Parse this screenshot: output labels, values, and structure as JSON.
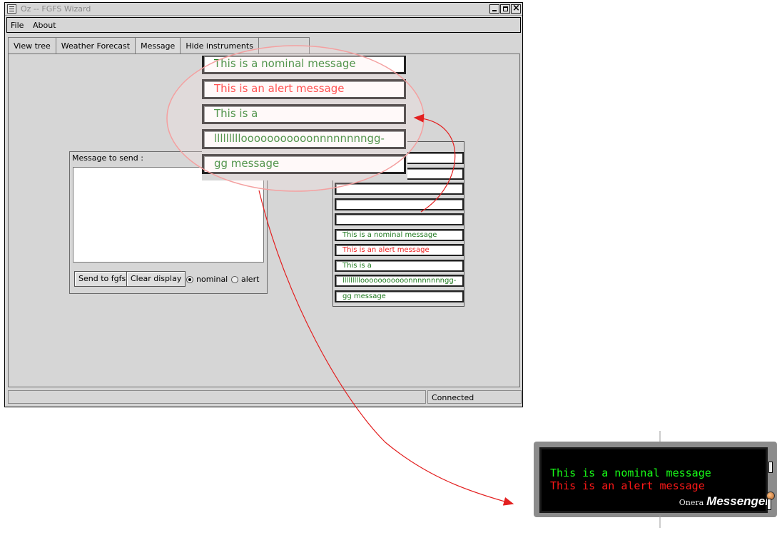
{
  "window": {
    "title": "Oz -- FGFS Wizard"
  },
  "menu": {
    "file": "File",
    "about": "About"
  },
  "tabs": [
    "View tree",
    "Weather Forecast",
    "Message",
    "Hide instruments",
    ""
  ],
  "composer": {
    "label": "Message to send :",
    "message_text": "",
    "send_button": "Send to fgfs",
    "clear_button": "Clear display",
    "radio_nominal": "nominal",
    "radio_alert": "alert",
    "selected_mode": "nominal"
  },
  "display_list": {
    "messages": [
      {
        "text": "",
        "level": "nominal"
      },
      {
        "text": "",
        "level": "nominal"
      },
      {
        "text": "",
        "level": "nominal"
      },
      {
        "text": "",
        "level": "nominal"
      },
      {
        "text": "",
        "level": "nominal"
      },
      {
        "text": "This is a nominal message",
        "level": "nominal"
      },
      {
        "text": "This is an alert message",
        "level": "alert"
      },
      {
        "text": "This is a",
        "level": "nominal"
      },
      {
        "text": "lllllllllooooooooooonnnnnnnngg-",
        "level": "nominal"
      },
      {
        "text": "gg message",
        "level": "nominal"
      }
    ]
  },
  "zoom_view": {
    "messages": [
      {
        "text": "This is a nominal message",
        "level": "nominal"
      },
      {
        "text": "This is an alert message",
        "level": "alert"
      },
      {
        "text": "This is a",
        "level": "nominal"
      },
      {
        "text": "lllllllllooooooooooonnnnnnnngg-",
        "level": "nominal"
      },
      {
        "text": "gg message",
        "level": "nominal"
      }
    ]
  },
  "status": {
    "left": "",
    "connection": "Connected"
  },
  "messenger": {
    "nominal_line": "This is a nominal message",
    "alert_line": "This is an alert message",
    "brand_prefix": "Onera",
    "brand_name": "Messenger"
  },
  "colors": {
    "nominal": "#1f7a1f",
    "alert": "#ef2020",
    "messenger_nominal": "#18ff18",
    "messenger_alert": "#ff1818",
    "annotation": "#e32020"
  }
}
